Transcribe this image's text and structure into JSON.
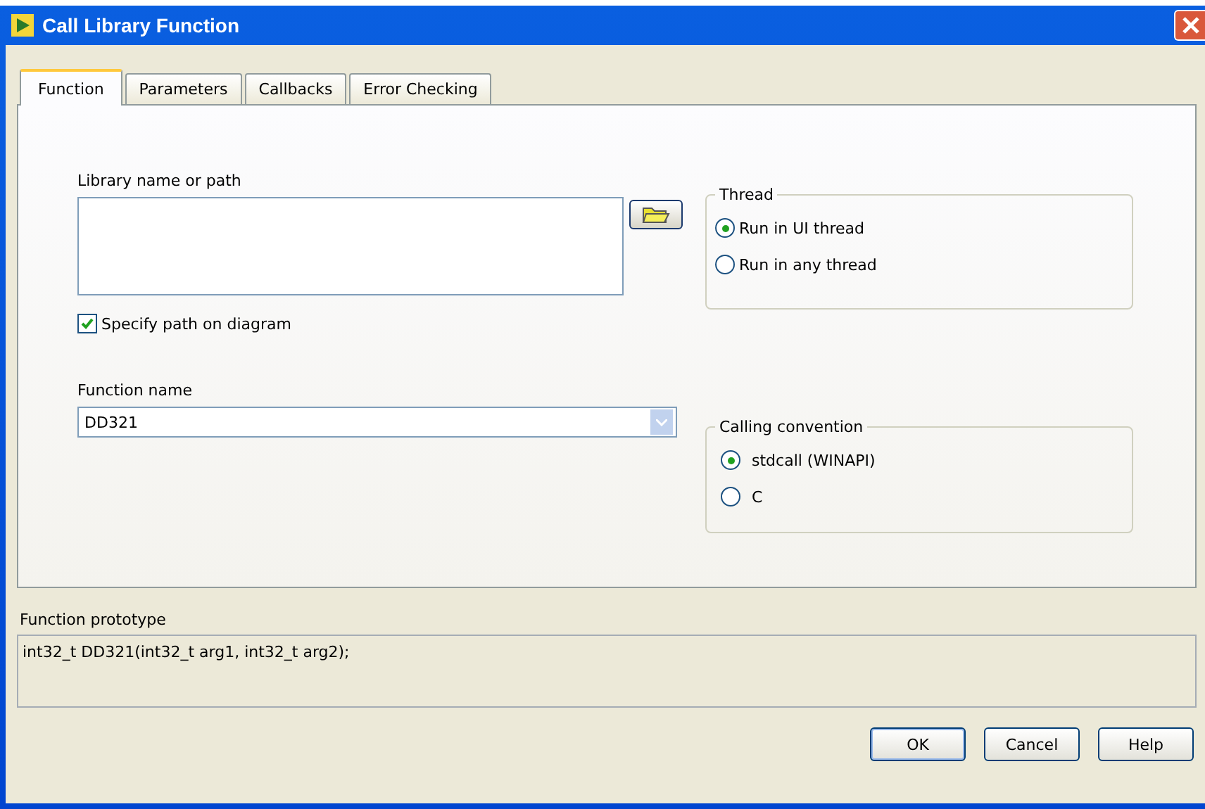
{
  "window": {
    "title": "Call Library Function"
  },
  "tabs": [
    {
      "label": "Function",
      "selected": true
    },
    {
      "label": "Parameters",
      "selected": false
    },
    {
      "label": "Callbacks",
      "selected": false
    },
    {
      "label": "Error Checking",
      "selected": false
    }
  ],
  "library": {
    "label": "Library name or path"
  },
  "specify_path": {
    "label": "Specify path on diagram",
    "checked": true
  },
  "function_name": {
    "label": "Function name",
    "value": "DD321"
  },
  "thread": {
    "title": "Thread",
    "options": [
      {
        "label": "Run in UI thread",
        "selected": true
      },
      {
        "label": "Run in any thread",
        "selected": false
      }
    ]
  },
  "calling_convention": {
    "title": "Calling convention",
    "options": [
      {
        "label": "stdcall (WINAPI)",
        "selected": true
      },
      {
        "label": "C",
        "selected": false
      }
    ]
  },
  "prototype": {
    "label": "Function prototype",
    "value": "int32_t DD321(int32_t arg1, int32_t arg2);"
  },
  "buttons": [
    {
      "label": "OK",
      "kind": "default"
    },
    {
      "label": "Cancel",
      "kind": "normal"
    },
    {
      "label": "Help",
      "kind": "normal"
    }
  ]
}
